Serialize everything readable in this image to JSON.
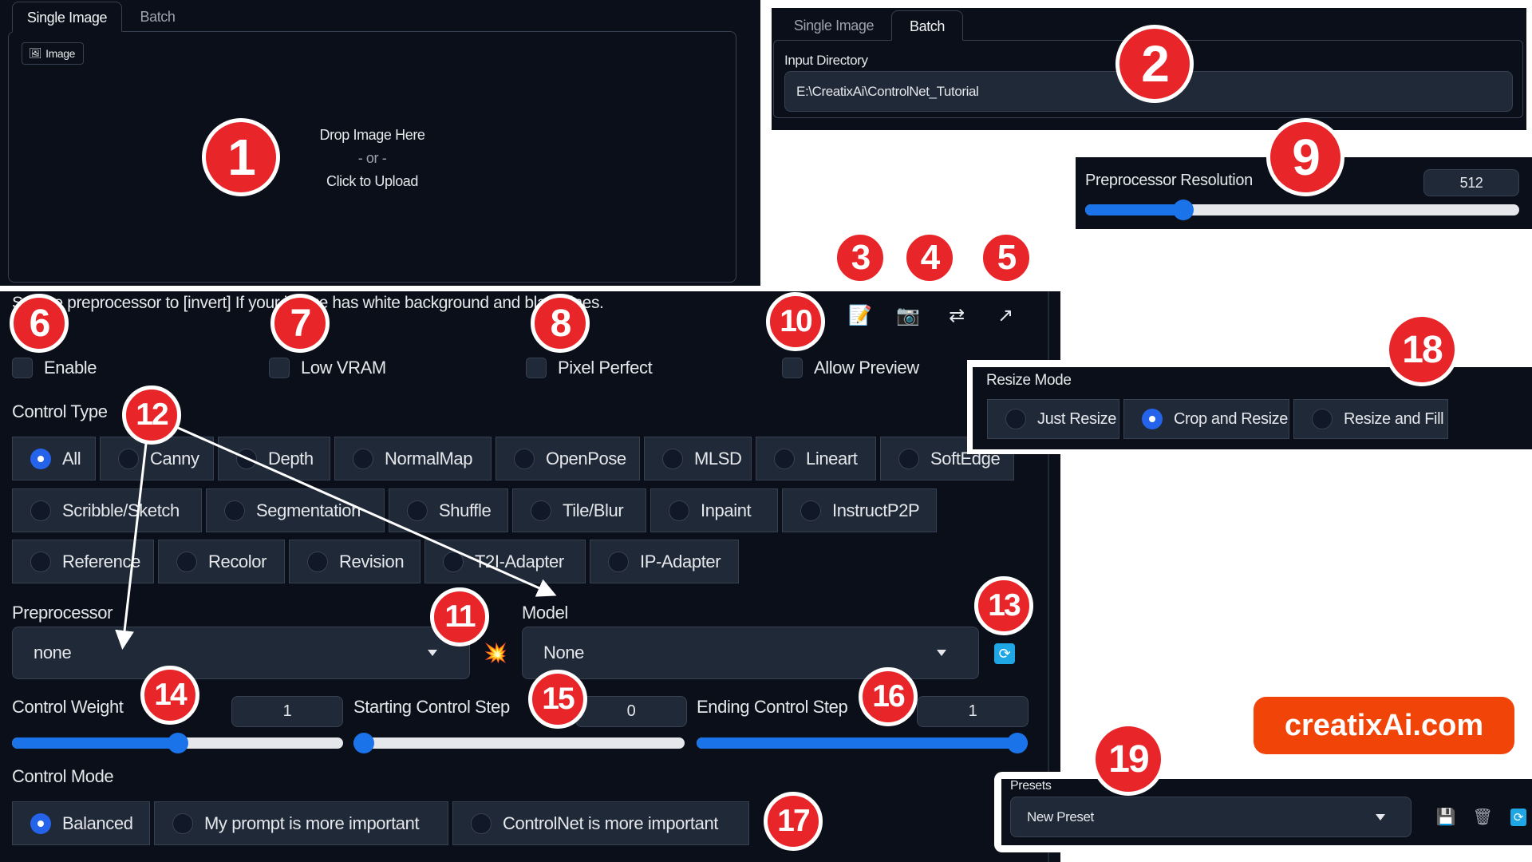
{
  "upload_panel": {
    "tabs": [
      {
        "label": "Single Image",
        "active": true
      },
      {
        "label": "Batch",
        "active": false
      }
    ],
    "image_chip": "Image",
    "drop_text": "Drop Image Here",
    "or_text": "- or -",
    "click_text": "Click to Upload"
  },
  "batch_panel": {
    "tabs": [
      {
        "label": "Single Image",
        "active": false
      },
      {
        "label": "Batch",
        "active": true
      }
    ],
    "input_directory_label": "Input Directory",
    "input_directory_value": "E:\\CreatixAi\\ControlNet_Tutorial"
  },
  "resolution_panel": {
    "label": "Preprocessor Resolution",
    "value": 512,
    "value_text": "512",
    "min": 64,
    "max": 2048
  },
  "main": {
    "hint": "Set the preprocessor to [invert] If your image has white background and black lines.",
    "toolbar_icons": [
      "edit-document-icon",
      "camera-icon",
      "swap-arrows-icon",
      "send-dimensions-icon"
    ],
    "checkboxes": [
      {
        "label": "Enable",
        "checked": false
      },
      {
        "label": "Low VRAM",
        "checked": false
      },
      {
        "label": "Pixel Perfect",
        "checked": false
      },
      {
        "label": "Allow Preview",
        "checked": false
      }
    ],
    "control_type_label": "Control Type",
    "control_types": [
      [
        "All",
        "Canny",
        "Depth",
        "NormalMap",
        "OpenPose",
        "MLSD",
        "Lineart",
        "SoftEdge"
      ],
      [
        "Scribble/Sketch",
        "Segmentation",
        "Shuffle",
        "Tile/Blur",
        "Inpaint",
        "InstructP2P"
      ],
      [
        "Reference",
        "Recolor",
        "Revision",
        "T2I-Adapter",
        "IP-Adapter"
      ]
    ],
    "control_type_selected": "All",
    "preprocessor_label": "Preprocessor",
    "preprocessor_value": "none",
    "model_label": "Model",
    "model_value": "None",
    "sliders": [
      {
        "label": "Control Weight",
        "value": 1,
        "value_text": "1",
        "min": 0,
        "max": 2
      },
      {
        "label": "Starting Control Step",
        "value": 0,
        "value_text": "0",
        "min": 0,
        "max": 1
      },
      {
        "label": "Ending Control Step",
        "value": 1,
        "value_text": "1",
        "min": 0,
        "max": 1
      }
    ],
    "control_mode_label": "Control Mode",
    "control_modes": [
      "Balanced",
      "My prompt is more important",
      "ControlNet is more important"
    ],
    "control_mode_selected": "Balanced"
  },
  "resize_panel": {
    "label": "Resize Mode",
    "options": [
      "Just Resize",
      "Crop and Resize",
      "Resize and Fill"
    ],
    "selected": "Crop and Resize"
  },
  "presets_panel": {
    "label": "Presets",
    "value": "New Preset"
  },
  "logo": "creatixAi.com",
  "badges": [
    "1",
    "2",
    "3",
    "4",
    "5",
    "6",
    "7",
    "8",
    "9",
    "10",
    "11",
    "12",
    "13",
    "14",
    "15",
    "16",
    "17",
    "18",
    "19"
  ],
  "colors": {
    "accent": "#1a73e8",
    "badge": "#e8262a",
    "panel_bg": "#0b0f19",
    "input_bg": "#1f2937",
    "logo_bg": "#f04408"
  }
}
